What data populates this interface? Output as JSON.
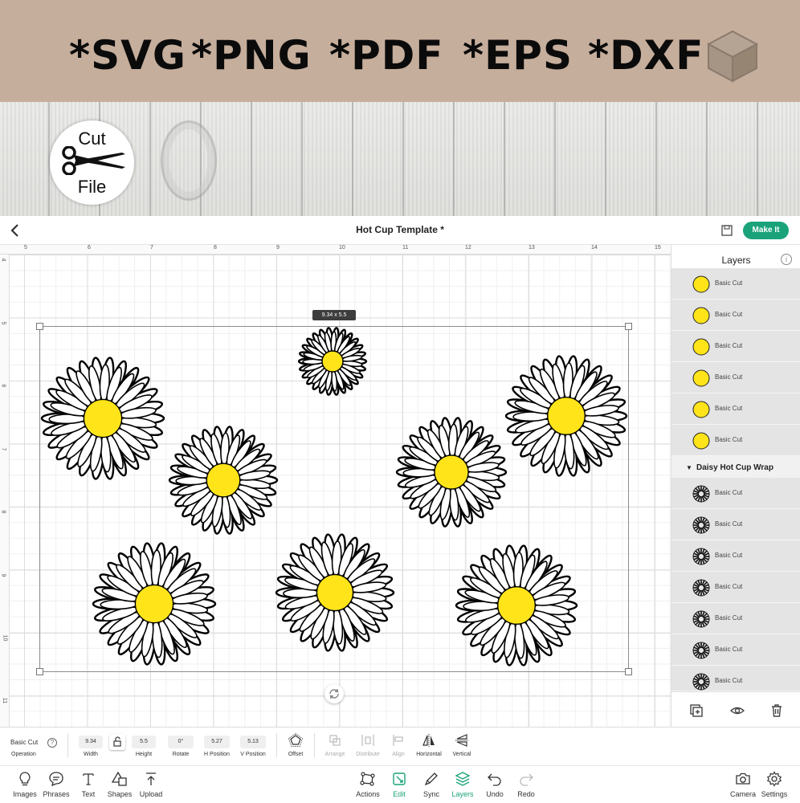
{
  "banner": {
    "formats": [
      "*SVG",
      "*PNG",
      "*PDF",
      "*EPS",
      "*DXF"
    ],
    "cut_badge": {
      "line1": "Cut",
      "line2": "File"
    }
  },
  "header": {
    "title": "Hot Cup Template *",
    "make_it_label": "Make It"
  },
  "canvas": {
    "ruler_top": [
      "5",
      "6",
      "7",
      "8",
      "9",
      "10",
      "11",
      "12",
      "13",
      "14",
      "15"
    ],
    "ruler_left": [
      "4",
      "5",
      "6",
      "7",
      "8",
      "9",
      "10",
      "11"
    ],
    "dimension_tag": "9.34 x 5.5"
  },
  "layers": {
    "title": "Layers",
    "items_top": [
      "Basic Cut",
      "Basic Cut",
      "Basic Cut",
      "Basic Cut",
      "Basic Cut",
      "Basic Cut"
    ],
    "group_name": "Daisy Hot Cup Wrap",
    "items_group": [
      "Basic Cut",
      "Basic Cut",
      "Basic Cut",
      "Basic Cut",
      "Basic Cut",
      "Basic Cut",
      "Basic Cut"
    ],
    "colors": {
      "yellow": "#ffe419",
      "accent": "#1aa37a"
    }
  },
  "properties": {
    "operation_value": "Basic Cut",
    "operation_label": "Operation",
    "width_value": "9.34",
    "width_label": "Width",
    "height_value": "5.5",
    "height_label": "Height",
    "rotate_value": "0°",
    "rotate_label": "Rotate",
    "hpos_value": "5.27",
    "hpos_label": "H Position",
    "vpos_value": "5.13",
    "vpos_label": "V Position",
    "offset_label": "Offset",
    "arrange_label": "Arrange",
    "distribute_label": "Distribute",
    "align_label": "Align",
    "horizontal_label": "Horizontal",
    "vertical_label": "Vertical"
  },
  "bottom_toolbar": {
    "images": "Images",
    "phrases": "Phrases",
    "text": "Text",
    "shapes": "Shapes",
    "upload": "Upload",
    "actions": "Actions",
    "edit": "Edit",
    "sync": "Sync",
    "layers": "Layers",
    "undo": "Undo",
    "redo": "Redo",
    "camera": "Camera",
    "settings": "Settings"
  }
}
